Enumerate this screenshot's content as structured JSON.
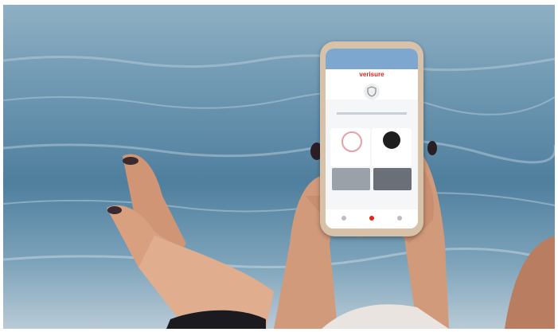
{
  "scene": {
    "colors": {
      "sea": "#5b88a6",
      "skin": "#d9a07f",
      "phone_case": "#d7c1a8",
      "brand_red": "#e2231a"
    }
  },
  "phone_app": {
    "brand": "verisure",
    "icons": [
      "shield-icon",
      "lock-icon",
      "camera-icon",
      "home-icon"
    ]
  }
}
